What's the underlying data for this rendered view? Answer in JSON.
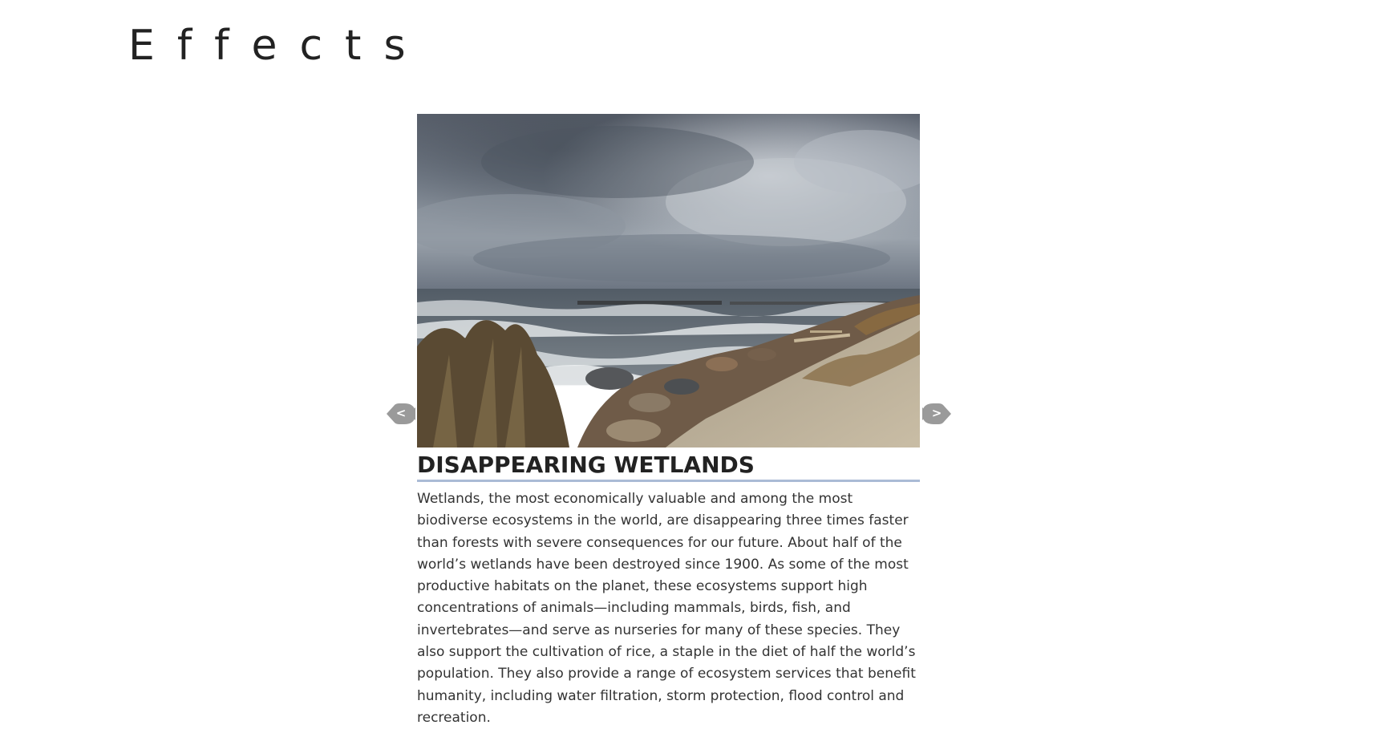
{
  "page": {
    "title": "Effects"
  },
  "slider": {
    "prev_label": "<",
    "next_label": ">",
    "arrow_color": "#9a9a9a",
    "slide": {
      "image_description": "stormy-coastline-photo",
      "heading": "DISAPPEARING WETLANDS",
      "heading_underline_color": "#aabbd6",
      "body": "Wetlands, the most economically valuable and among the most biodiverse ecosystems in the world, are disappearing three times faster than forests with severe consequences for our future. About half of the world’s wetlands have been destroyed since 1900. As some of the most productive habitats on the planet, these ecosystems support high concentrations of animals—including mammals, birds, fish, and invertebrates—and serve as nurseries for many of these species. They also support the cultivation of rice, a staple in the diet of half the world’s population. They also provide a range of ecosystem services that benefit humanity, including water filtration, storm protection, flood control and recreation."
    }
  }
}
